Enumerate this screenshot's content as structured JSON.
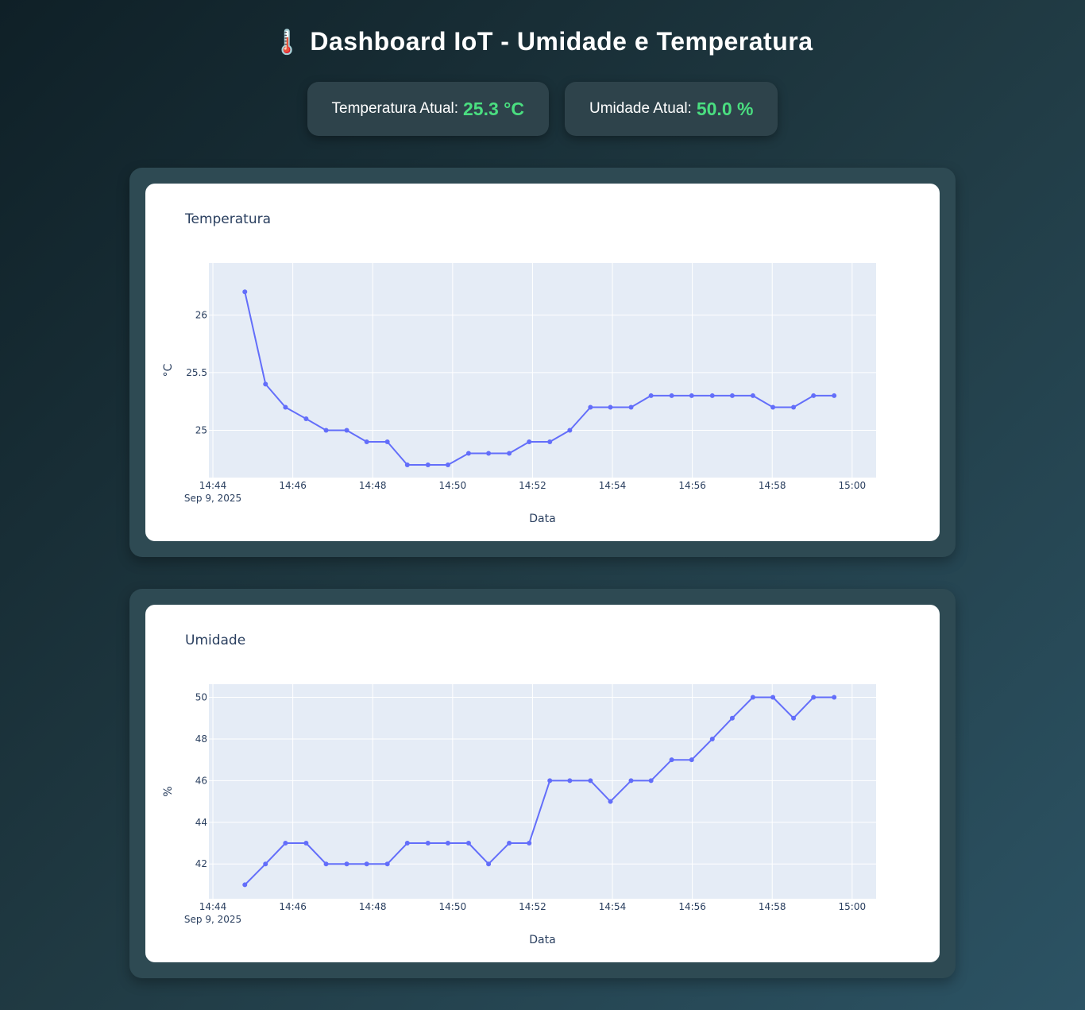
{
  "header": {
    "icon": "🌡️",
    "title": "Dashboard IoT - Umidade e Temperatura"
  },
  "cards": [
    {
      "label": "Temperatura Atual:",
      "value": "25.3 °C"
    },
    {
      "label": "Umidade Atual:",
      "value": "50.0 %"
    }
  ],
  "colors": {
    "line": "#636efa",
    "value_green": "#4ade80",
    "plot_bg": "#e5ecf6"
  },
  "chart_data": [
    {
      "type": "line",
      "title": "Temperatura",
      "xlabel": "Data",
      "ylabel": "°C",
      "x_date_label": "Sep 9, 2025",
      "x_tick_labels": [
        "14:44",
        "14:46",
        "14:48",
        "14:50",
        "14:52",
        "14:54",
        "14:56",
        "14:58",
        "15:00"
      ],
      "x_range": [
        "14:43:54",
        "15:00:36"
      ],
      "y_ticks": [
        25,
        25.5,
        26
      ],
      "y_tick_labels": [
        "25",
        "25.5",
        "26"
      ],
      "ylim": [
        24.59,
        26.45
      ],
      "grid": true,
      "x": [
        "14:44:48",
        "14:45:19",
        "14:45:49",
        "14:46:20",
        "14:46:50",
        "14:47:21",
        "14:47:51",
        "14:48:22",
        "14:48:52",
        "14:49:23",
        "14:49:53",
        "14:50:24",
        "14:50:54",
        "14:51:25",
        "14:51:55",
        "14:52:26",
        "14:52:56",
        "14:53:27",
        "14:53:57",
        "14:54:28",
        "14:54:58",
        "14:55:29",
        "14:55:59",
        "14:56:30",
        "14:57:00",
        "14:57:31",
        "14:58:01",
        "14:58:32",
        "14:59:02",
        "14:59:33"
      ],
      "values": [
        26.2,
        25.4,
        25.2,
        25.1,
        25.0,
        25.0,
        24.9,
        24.9,
        24.7,
        24.7,
        24.7,
        24.8,
        24.8,
        24.8,
        24.9,
        24.9,
        25.0,
        25.2,
        25.2,
        25.2,
        25.3,
        25.3,
        25.3,
        25.3,
        25.3,
        25.3,
        25.2,
        25.2,
        25.3,
        25.3
      ]
    },
    {
      "type": "line",
      "title": "Umidade",
      "xlabel": "Data",
      "ylabel": "%",
      "x_date_label": "Sep 9, 2025",
      "x_tick_labels": [
        "14:44",
        "14:46",
        "14:48",
        "14:50",
        "14:52",
        "14:54",
        "14:56",
        "14:58",
        "15:00"
      ],
      "x_range": [
        "14:43:54",
        "15:00:36"
      ],
      "y_ticks": [
        42,
        44,
        46,
        48,
        50
      ],
      "y_tick_labels": [
        "42",
        "44",
        "46",
        "48",
        "50"
      ],
      "ylim": [
        40.33,
        50.63
      ],
      "grid": true,
      "x": [
        "14:44:48",
        "14:45:19",
        "14:45:49",
        "14:46:20",
        "14:46:50",
        "14:47:21",
        "14:47:51",
        "14:48:22",
        "14:48:52",
        "14:49:23",
        "14:49:53",
        "14:50:24",
        "14:50:54",
        "14:51:25",
        "14:51:55",
        "14:52:26",
        "14:52:56",
        "14:53:27",
        "14:53:57",
        "14:54:28",
        "14:54:58",
        "14:55:29",
        "14:55:59",
        "14:56:30",
        "14:57:00",
        "14:57:31",
        "14:58:01",
        "14:58:32",
        "14:59:02",
        "14:59:33"
      ],
      "values": [
        41,
        42,
        43,
        43,
        42,
        42,
        42,
        42,
        43,
        43,
        43,
        43,
        42,
        43,
        43,
        46,
        46,
        46,
        45,
        46,
        46,
        47,
        47,
        48,
        49,
        50,
        50,
        49,
        50,
        50
      ]
    }
  ]
}
